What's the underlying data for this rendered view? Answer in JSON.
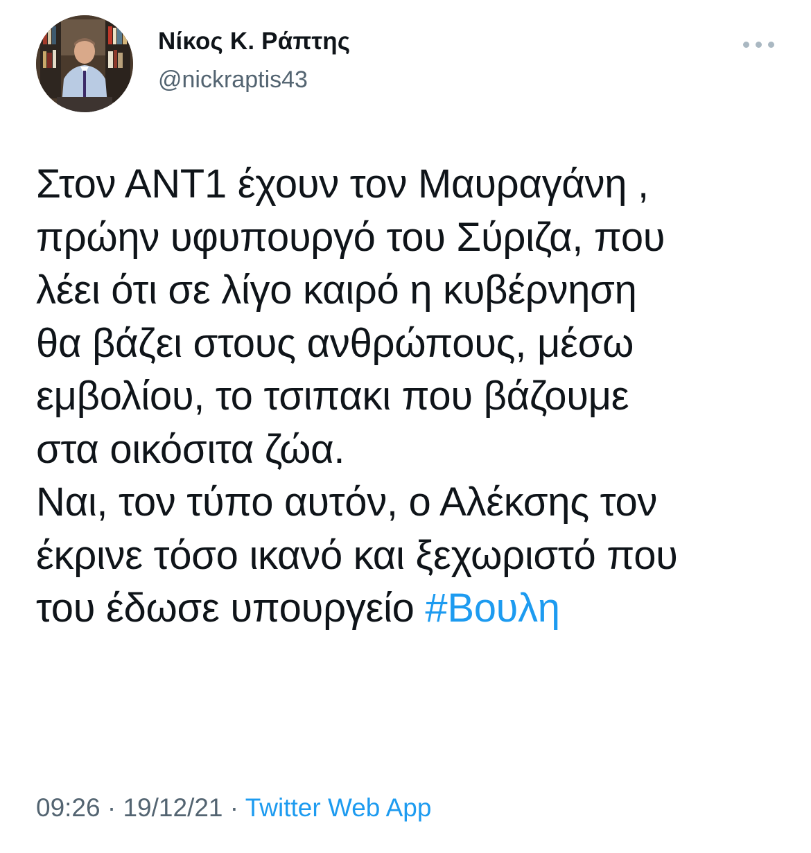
{
  "author": {
    "display_name": "Νίκος Κ. Ράπτης",
    "handle": "@nickraptis43",
    "avatar_icon": "person-avatar-photo"
  },
  "menu": {
    "icon": "more-options-icon"
  },
  "tweet": {
    "lines": [
      "Στον ΑΝΤ1 έχουν τον Μαυραγάνη ,",
      "πρώην υφυπουργό του Σύριζα, που",
      "λέει ότι σε λίγο καιρό η κυβέρνηση",
      "θα βάζει στους ανθρώπους, μέσω",
      "εμβολίου, το τσιπακι που βάζουμε",
      "στα οικόσιτα ζώα.",
      "Ναι, τον τύπο αυτόν, ο Αλέκσης τον",
      "έκρινε τόσο ικανό και ξεχωριστό που"
    ],
    "last_line_text": "του έδωσε υπουργείο ",
    "hashtag": "#Βουλη"
  },
  "meta": {
    "time": "09:26",
    "separator_1": " · ",
    "date": "19/12/21",
    "separator_2": " · ",
    "source": "Twitter Web App"
  },
  "colors": {
    "text": "#0f1419",
    "secondary": "#536471",
    "link": "#1d9bf0",
    "dots": "#aab8c2"
  }
}
